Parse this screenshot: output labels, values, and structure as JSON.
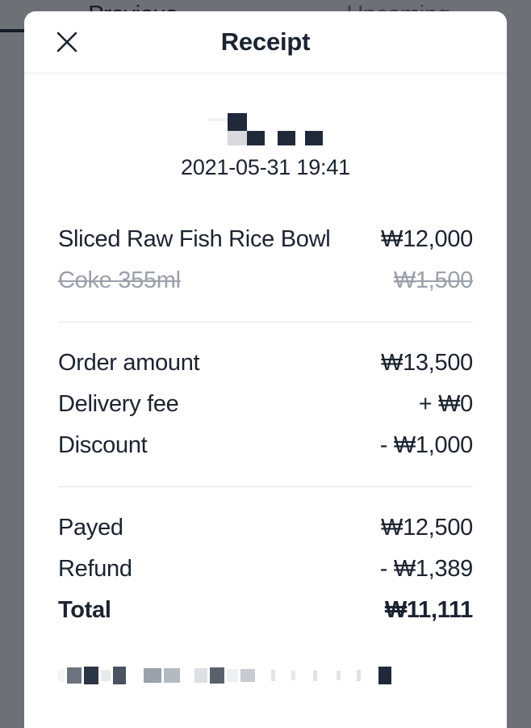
{
  "background": {
    "tabs": [
      {
        "label": "Previous",
        "active": true
      },
      {
        "label": "Upcoming",
        "active": false
      }
    ]
  },
  "modal": {
    "title": "Receipt",
    "close_icon": "close-icon",
    "order_id_redacted": true,
    "timestamp": "2021-05-31 19:41",
    "line_items": [
      {
        "label": "Sliced Raw Fish Rice Bowl",
        "value": "₩12,000",
        "cancelled": false
      },
      {
        "label": "Coke 355ml",
        "value": "₩1,500",
        "cancelled": true
      }
    ],
    "summary": [
      {
        "label": "Order amount",
        "value": "₩13,500"
      },
      {
        "label": "Delivery fee",
        "value": "+ ₩0"
      },
      {
        "label": "Discount",
        "value": "- ₩1,000"
      }
    ],
    "payment": [
      {
        "label": "Payed",
        "value": "₩12,500",
        "bold": false
      },
      {
        "label": "Refund",
        "value": "- ₩1,389",
        "bold": false
      },
      {
        "label": "Total",
        "value": "₩11,111",
        "bold": true
      }
    ],
    "footer_redacted": true
  },
  "colors": {
    "text_primary": "#1b2230",
    "text_muted": "#9aa0aa",
    "divider": "#e3e5e8",
    "overlay": "#14181f",
    "surface": "#ffffff"
  }
}
